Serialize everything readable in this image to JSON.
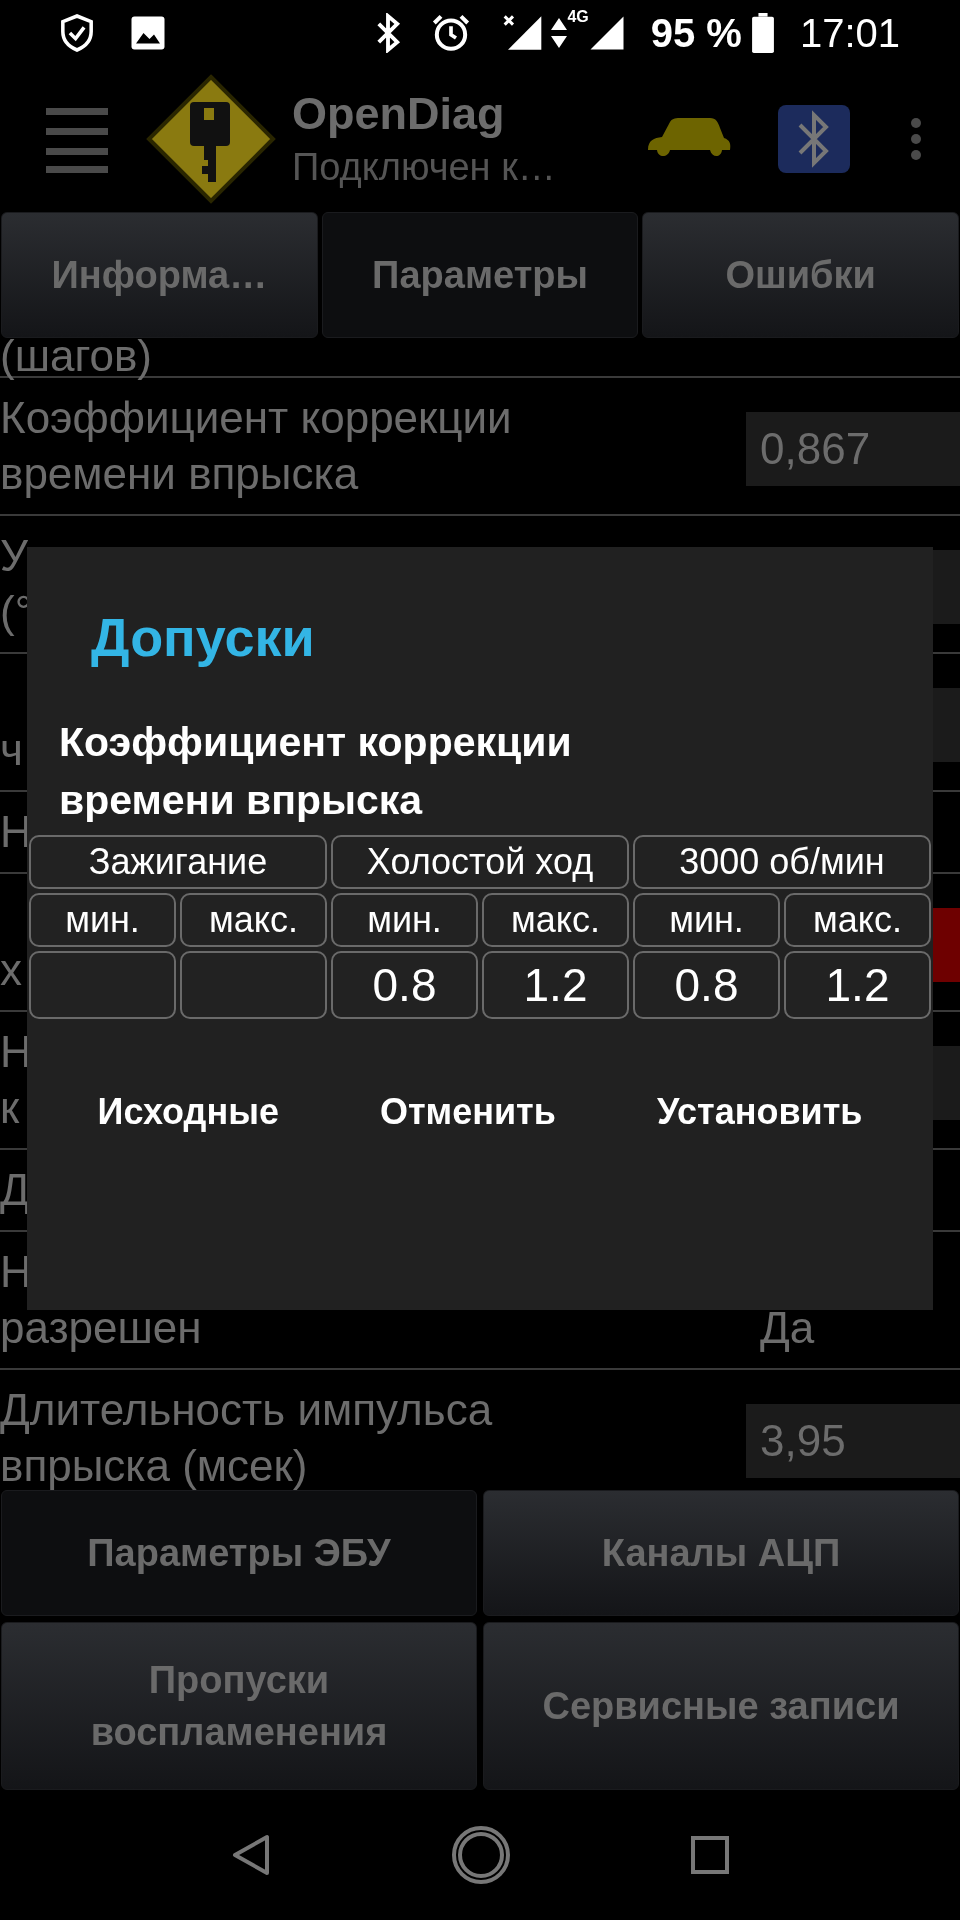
{
  "status_bar": {
    "network": "4G",
    "battery": "95 %",
    "time": "17:01"
  },
  "app_bar": {
    "title": "OpenDiag",
    "subtitle": "Подключен к…"
  },
  "tabs": [
    {
      "label": "Информа…",
      "selected": false
    },
    {
      "label": "Параметры",
      "selected": true
    },
    {
      "label": "Ошибки",
      "selected": false
    }
  ],
  "parameters": [
    {
      "lines": [
        "(шагов)"
      ],
      "field": false
    },
    {
      "lines": [
        "Коэффициент коррекции",
        "времени впрыска"
      ],
      "value": "0,867",
      "field": true,
      "alert": false
    },
    {
      "lines": [
        "У",
        "(°"
      ],
      "field": true,
      "alert": false
    },
    {
      "lines": [
        "ч"
      ],
      "field": true,
      "alert": false
    },
    {
      "lines": [
        "Н"
      ],
      "field": false
    },
    {
      "lines": [
        "х"
      ],
      "field": true,
      "alert": true
    },
    {
      "lines": [
        "Н",
        "к"
      ],
      "field": true,
      "alert": false
    },
    {
      "lines": [
        "Д"
      ],
      "field": false
    },
    {
      "lines": [
        "Н",
        "разрешен"
      ],
      "value": "Да",
      "field": false
    },
    {
      "lines": [
        "Длительность импульса",
        "впрыска (мсек)"
      ],
      "value": "3,95",
      "field": true,
      "alert": false
    }
  ],
  "dialog": {
    "title": "Допуски",
    "parameter": "Коэффициент коррекции времени впрыска",
    "groups": [
      {
        "label": "Зажигание",
        "min_label": "мин.",
        "max_label": "макс."
      },
      {
        "label": "Холостой ход",
        "min_label": "мин.",
        "max_label": "макс.",
        "min": "0.8",
        "max": "1.2"
      },
      {
        "label": "3000 об/мин",
        "min_label": "мин.",
        "max_label": "макс.",
        "min": "0.8",
        "max": "1.2"
      }
    ],
    "buttons": [
      "Исходные",
      "Отменить",
      "Установить"
    ]
  },
  "actions": [
    {
      "label": "Параметры ЭБУ",
      "selected": true
    },
    {
      "label": "Каналы АЦП",
      "selected": false
    },
    {
      "label": "Пропуски воспламенения",
      "selected": false
    },
    {
      "label": "Сервисные записи",
      "selected": false
    }
  ]
}
